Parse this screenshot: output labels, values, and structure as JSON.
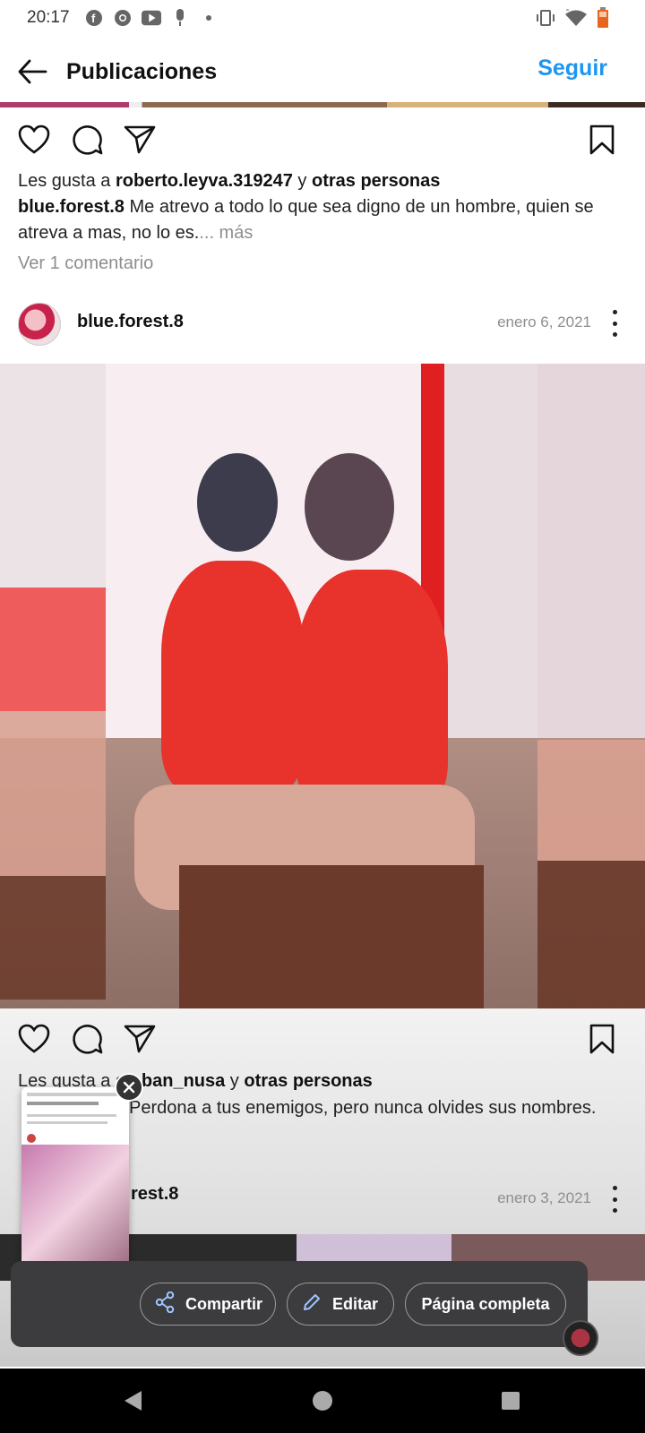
{
  "status_bar": {
    "time": "20:17",
    "icons": [
      "facebook-icon",
      "chrome-icon",
      "youtube-icon",
      "microphone-icon",
      "dot-icon",
      "vibrate-icon",
      "wifi-icon",
      "battery-icon"
    ]
  },
  "header": {
    "title": "Publicaciones",
    "follow_label": "Seguir",
    "accent_color": "#1e96f0"
  },
  "post_prev": {
    "likes_prefix": "Les gusta a ",
    "likes_user": "roberto.leyva.319247",
    "likes_joiner": " y ",
    "likes_suffix": "otras personas",
    "caption_user": "blue.forest.8",
    "caption_text": " Me atrevo a todo lo que sea digno de un hombre, quien se atreva a mas, no lo es.",
    "more_label": "... más",
    "comments_label": "Ver 1 comentario"
  },
  "post": {
    "username": "blue.forest.8",
    "date": "enero 6, 2021",
    "likes_prefix": "Les gusta a",
    "likes_user": "steban_nusa",
    "likes_joiner": " y ",
    "likes_suffix": "otras personas",
    "caption_text": "Perdona a tus enemigos, pero nunca olvides sus nombres."
  },
  "next_post": {
    "username_partial": "rest.8",
    "date": "enero 3, 2021"
  },
  "share_bar": {
    "share_label": "Compartir",
    "edit_label": "Editar",
    "fullpage_label": "Página completa"
  }
}
